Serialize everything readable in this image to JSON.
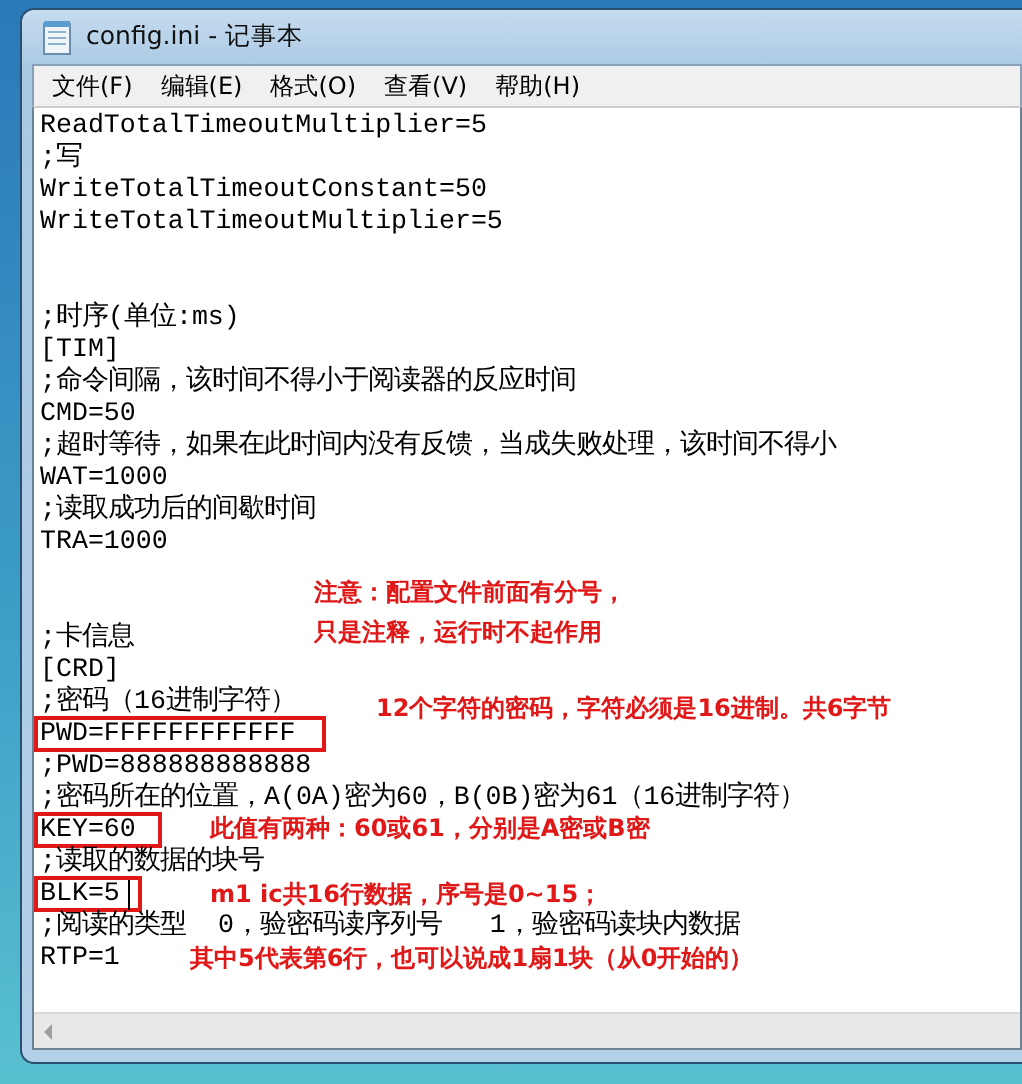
{
  "window": {
    "title": "config.ini - 记事本"
  },
  "menu": [
    {
      "label": "文件(F)"
    },
    {
      "label": "编辑(E)"
    },
    {
      "label": "格式(O)"
    },
    {
      "label": "查看(V)"
    },
    {
      "label": "帮助(H)"
    }
  ],
  "lines": [
    {
      "kind": "text",
      "text": "ReadTotalTimeoutMultiplier=5",
      "highlighted": false,
      "cursor": false
    },
    {
      "kind": "text",
      "text": ";写",
      "highlighted": false,
      "cursor": false
    },
    {
      "kind": "text",
      "text": "WriteTotalTimeoutConstant=50",
      "highlighted": false,
      "cursor": false
    },
    {
      "kind": "text",
      "text": "WriteTotalTimeoutMultiplier=5",
      "highlighted": false,
      "cursor": false
    },
    {
      "kind": "blank"
    },
    {
      "kind": "blank"
    },
    {
      "kind": "text",
      "text": ";时序(单位:ms)",
      "highlighted": false,
      "cursor": false
    },
    {
      "kind": "text",
      "text": "[TIM]",
      "highlighted": false,
      "cursor": false
    },
    {
      "kind": "text",
      "text": ";命令间隔，该时间不得小于阅读器的反应时间",
      "highlighted": false,
      "cursor": false
    },
    {
      "kind": "text",
      "text": "CMD=50",
      "highlighted": false,
      "cursor": false
    },
    {
      "kind": "text",
      "text": ";超时等待，如果在此时间内没有反馈，当成失败处理，该时间不得小",
      "highlighted": false,
      "cursor": false
    },
    {
      "kind": "text",
      "text": "WAT=1000",
      "highlighted": false,
      "cursor": false
    },
    {
      "kind": "text",
      "text": ";读取成功后的间歇时间",
      "highlighted": false,
      "cursor": false
    },
    {
      "kind": "text",
      "text": "TRA=1000",
      "highlighted": false,
      "cursor": false
    },
    {
      "kind": "blank"
    },
    {
      "kind": "blank"
    },
    {
      "kind": "text",
      "text": ";卡信息",
      "highlighted": false,
      "cursor": false
    },
    {
      "kind": "text",
      "text": "[CRD]",
      "highlighted": false,
      "cursor": false
    },
    {
      "kind": "text",
      "text": ";密码（16进制字符）",
      "highlighted": false,
      "cursor": false
    },
    {
      "kind": "text",
      "text": "PWD=FFFFFFFFFFFF",
      "highlighted": true,
      "cursor": false
    },
    {
      "kind": "text",
      "text": ";PWD=888888888888",
      "highlighted": false,
      "cursor": false
    },
    {
      "kind": "text",
      "text": ";密码所在的位置，A(0A)密为60，B(0B)密为61（16进制字符）",
      "highlighted": false,
      "cursor": false
    },
    {
      "kind": "text",
      "text": "KEY=60",
      "highlighted": true,
      "cursor": false
    },
    {
      "kind": "text",
      "text": ";读取的数据的块号",
      "highlighted": false,
      "cursor": false
    },
    {
      "kind": "text",
      "text": "BLK=5",
      "highlighted": true,
      "cursor": true
    },
    {
      "kind": "text",
      "text": ";阅读的类型  0，验密码读序列号   1，验密码读块内数据",
      "highlighted": false,
      "cursor": false
    },
    {
      "kind": "text",
      "text": "RTP=1",
      "highlighted": false,
      "cursor": false
    }
  ],
  "annotations": [
    {
      "lines": [
        "注意：配置文件前面有分号，",
        "只是注释，运行时不起作用"
      ]
    },
    {
      "lines": [
        "12个字符的密码，字符必须是16进制。共6字节"
      ]
    },
    {
      "lines": [
        "此值有两种：60或61，分别是A密或B密"
      ]
    },
    {
      "lines": [
        "m1 ic共16行数据，序号是0~15；",
        "其中5代表第6行，也可以说成1扇1块（从0开始的）"
      ]
    }
  ]
}
